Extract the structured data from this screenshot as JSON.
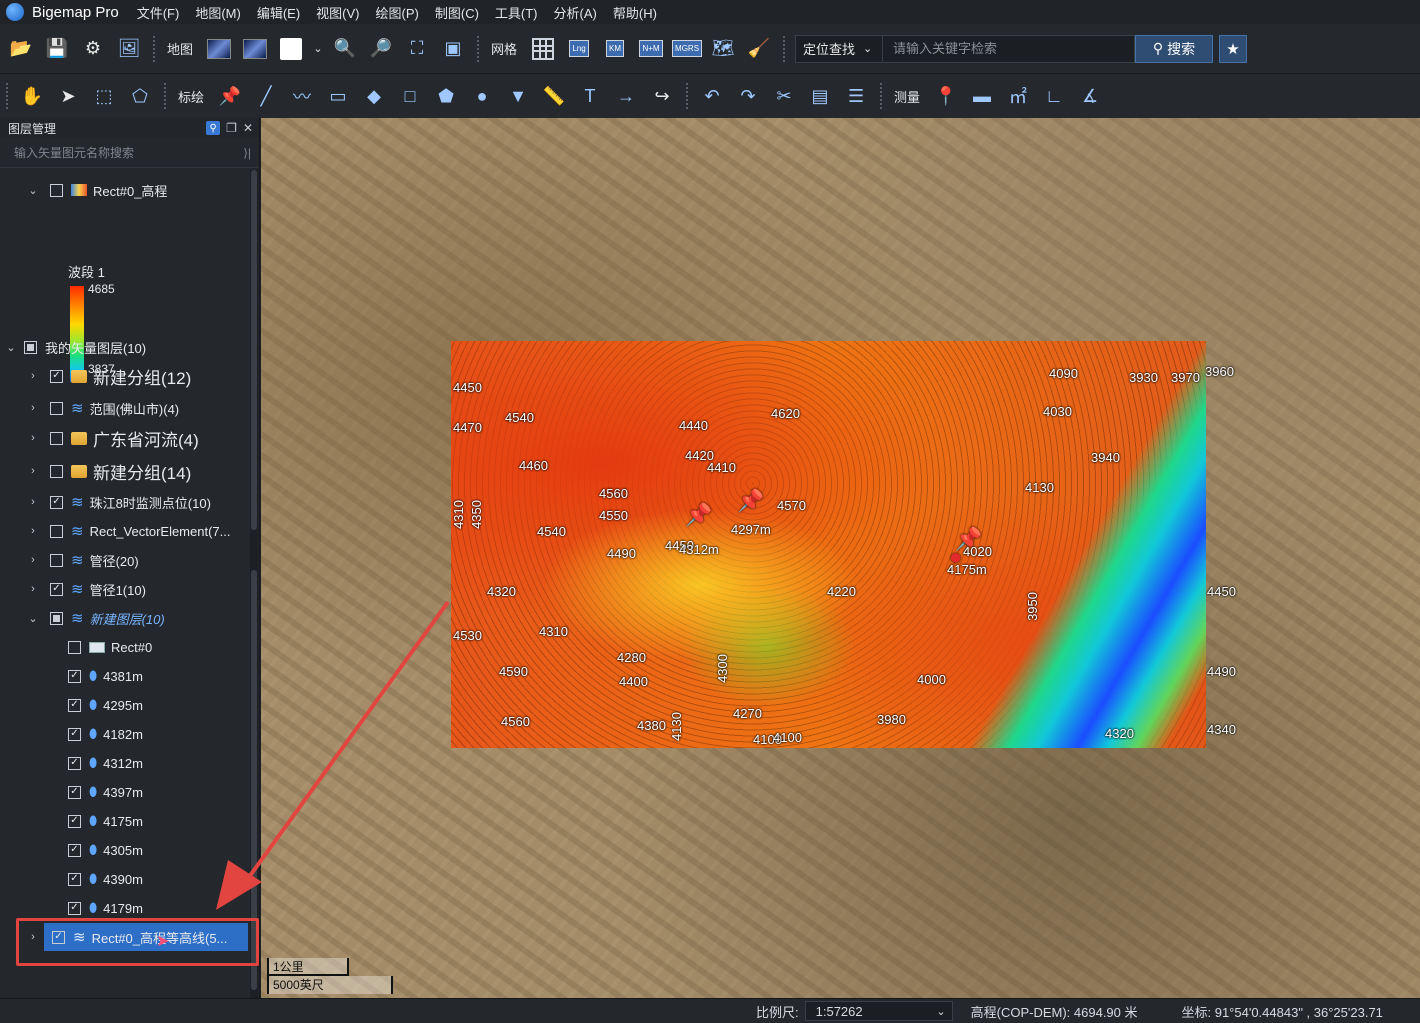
{
  "app": {
    "title": "Bigemap Pro"
  },
  "menu": [
    "文件(F)",
    "地图(M)",
    "编辑(E)",
    "视图(V)",
    "绘图(P)",
    "制图(C)",
    "工具(T)",
    "分析(A)",
    "帮助(H)"
  ],
  "toolbar1": {
    "map_label": "地图",
    "grid_label": "网格",
    "grid_badges": [
      "Lng",
      "KM",
      "N+M",
      "MGRS"
    ],
    "locate_dropdown": "定位查找",
    "search_placeholder": "请输入关键字检索",
    "search_button": "搜索"
  },
  "toolbar2": {
    "draw_label": "标绘",
    "measure_label": "测量"
  },
  "panel": {
    "title": "图层管理",
    "search_placeholder": "输入矢量图元名称搜索",
    "legend": {
      "band": "波段 1",
      "max": "4685",
      "min": "3837"
    },
    "rows": [
      {
        "label": "Rect#0_高程"
      },
      {
        "label": "我的矢量图层(10)"
      },
      {
        "label": "新建分组(12)"
      },
      {
        "label": "范围(佛山市)(4)"
      },
      {
        "label": "广东省河流(4)"
      },
      {
        "label": "新建分组(14)"
      },
      {
        "label": "珠江8时监测点位(10)"
      },
      {
        "label": "Rect_VectorElement(7..."
      },
      {
        "label": "管径(20)"
      },
      {
        "label": "管径1(10)"
      },
      {
        "label": "新建图层(10)"
      },
      {
        "label": "Rect#0"
      },
      {
        "label": "4381m"
      },
      {
        "label": "4295m"
      },
      {
        "label": "4182m"
      },
      {
        "label": "4312m"
      },
      {
        "label": "4397m"
      },
      {
        "label": "4175m"
      },
      {
        "label": "4305m"
      },
      {
        "label": "4390m"
      },
      {
        "label": "4179m"
      },
      {
        "label": "Rect#0_高程等高线(5..."
      }
    ]
  },
  "map": {
    "contour_labels": [
      "4450",
      "4470",
      "4540",
      "4460",
      "4440",
      "4620",
      "4420",
      "4410",
      "4570",
      "4090",
      "4030",
      "3970",
      "3960",
      "3930",
      "3940",
      "4130",
      "4550",
      "4540",
      "4560",
      "4490",
      "4450",
      "4320",
      "4310",
      "4280",
      "4400",
      "4270",
      "4100",
      "4380",
      "4130",
      "4220",
      "4020",
      "4000",
      "3980",
      "3950",
      "4100",
      "4320",
      "4340",
      "4450",
      "4490",
      "4530",
      "4590",
      "4560",
      "4300",
      "4310",
      "4350"
    ],
    "pin_labels": [
      "4297m",
      "4312m",
      "4175m"
    ],
    "scale_km": "1公里",
    "scale_ft": "5000英尺"
  },
  "status": {
    "scale_label": "比例尺:",
    "scale_value": "1:57262",
    "elevation": "高程(COP-DEM): 4694.90 米",
    "coord": "坐标: 91°54'0.44843\" , 36°25'23.71"
  }
}
